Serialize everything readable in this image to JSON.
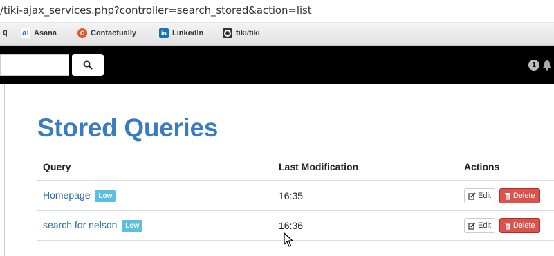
{
  "browser": {
    "url": "/tiki-ajax_services.php?controller=search_stored&action=list",
    "bookmarks": [
      {
        "label": "q",
        "icon": "none"
      },
      {
        "label": "Asana",
        "icon": "asana-icon"
      },
      {
        "label": "Contactually",
        "icon": "contactually-icon"
      },
      {
        "label": "LinkedIn",
        "icon": "linkedin-icon"
      },
      {
        "label": "tiki/tiki",
        "icon": "github-icon"
      }
    ]
  },
  "topnav": {
    "search_placeholder": "",
    "search_icon": "search-icon",
    "notifications_count": "1",
    "bell_icon": "bell-icon"
  },
  "page": {
    "title": "Stored Queries"
  },
  "table": {
    "headers": {
      "query": "Query",
      "last_modification": "Last Modification",
      "actions": "Actions"
    },
    "rows": [
      {
        "query": "Homepage",
        "priority": "Low",
        "last_modification": "16:35",
        "edit_label": "Edit",
        "delete_label": "Delete"
      },
      {
        "query": "search for nelson",
        "priority": "Low",
        "last_modification": "16:36",
        "edit_label": "Edit",
        "delete_label": "Delete"
      }
    ]
  },
  "colors": {
    "title": "#3a7cbf",
    "link": "#2a6aa8",
    "label_low": "#5bc0de",
    "delete": "#d9534f",
    "navbar": "#000000"
  }
}
